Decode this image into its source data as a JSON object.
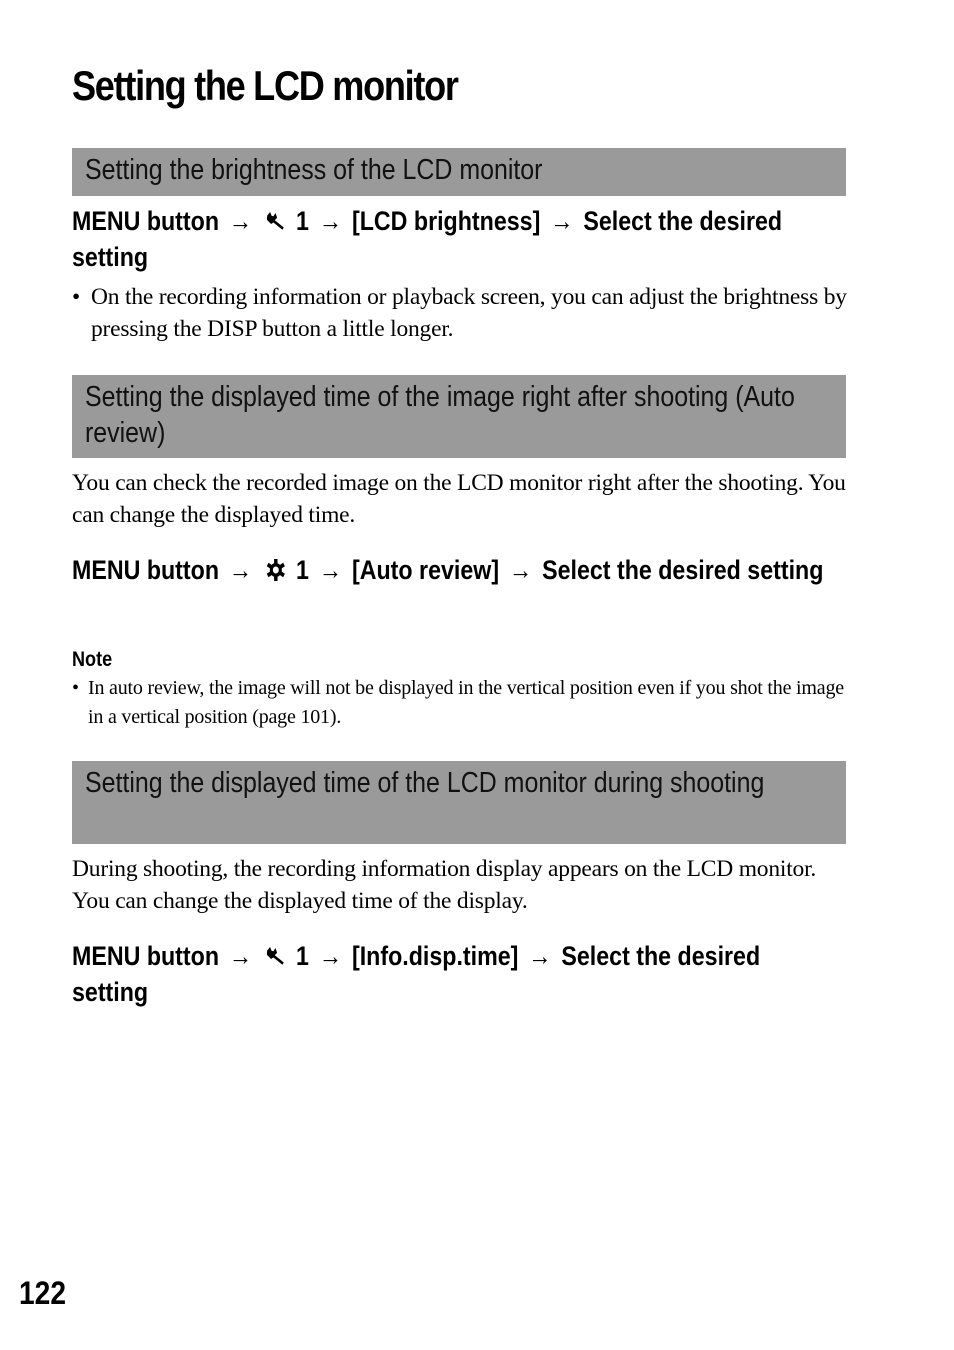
{
  "page": {
    "title": "Setting the LCD monitor",
    "page_number": "122"
  },
  "sections": [
    {
      "heading": "Setting the brightness of the LCD monitor",
      "menu_path": {
        "start": "MENU button",
        "arrow": "→",
        "icon": "wrench-icon",
        "tab": "1",
        "item": "[LCD brightness]",
        "end": "Select the desired setting"
      },
      "bullets": [
        "On the recording information or playback screen, you can adjust the brightness by pressing the DISP button a little longer."
      ]
    },
    {
      "heading": "Setting the displayed time of the image right after shooting (Auto review)",
      "intro": "You can check the recorded image on the LCD monitor right after the shooting. You can change the displayed time.",
      "menu_path": {
        "start": "MENU button",
        "arrow": "→",
        "icon": "gear-icon",
        "tab": "1",
        "item": "[Auto review]",
        "end": "Select the desired setting"
      },
      "note": {
        "label": "Note",
        "bullets": [
          "In auto review, the image will not be displayed in the vertical position even if you shot the image in a vertical position (page 101)."
        ]
      }
    },
    {
      "heading": "Setting the displayed time of the LCD monitor during shooting",
      "intro": "During shooting, the recording information display appears on the LCD monitor. You can change the displayed time of the display.",
      "menu_path": {
        "start": "MENU button",
        "arrow": "→",
        "icon": "wrench-icon",
        "tab": "1",
        "item": "[Info.disp.time]",
        "end": "Select the desired setting"
      }
    }
  ],
  "bullet_glyph": "•"
}
